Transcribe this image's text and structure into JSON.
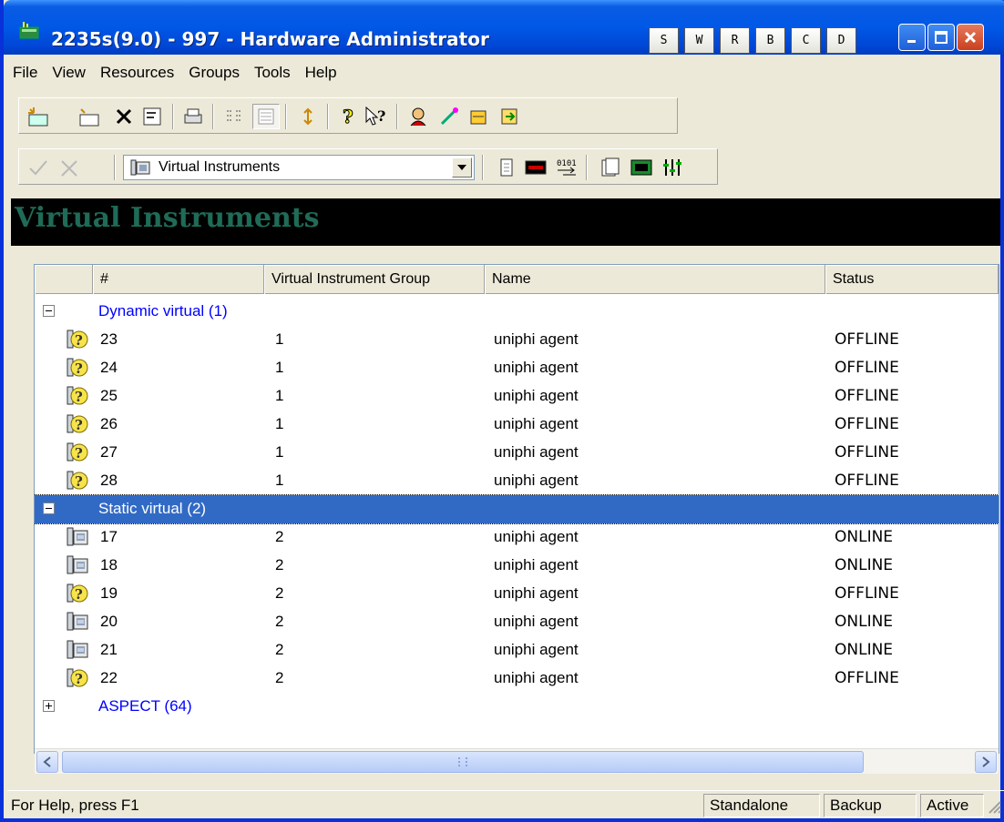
{
  "window": {
    "title": "2235s(9.0) - 997 - Hardware Administrator",
    "hw_buttons": [
      "S",
      "W",
      "R",
      "B",
      "C",
      "D"
    ]
  },
  "menu": [
    "File",
    "View",
    "Resources",
    "Groups",
    "Tools",
    "Help"
  ],
  "toolbar2": {
    "combo_value": "Virtual Instruments"
  },
  "banner": {
    "title": "Virtual Instruments"
  },
  "list": {
    "columns": [
      "#",
      "Virtual Instrument Group",
      "Name",
      "Status"
    ],
    "groups": [
      {
        "label": "Dynamic virtual (1)",
        "expanded": true,
        "rows": [
          {
            "num": "23",
            "group": "1",
            "name": "uniphi agent",
            "status": "OFFLINE",
            "icon": "offline-agent-icon"
          },
          {
            "num": "24",
            "group": "1",
            "name": "uniphi agent",
            "status": "OFFLINE",
            "icon": "offline-agent-icon"
          },
          {
            "num": "25",
            "group": "1",
            "name": "uniphi agent",
            "status": "OFFLINE",
            "icon": "offline-agent-icon"
          },
          {
            "num": "26",
            "group": "1",
            "name": "uniphi agent",
            "status": "OFFLINE",
            "icon": "offline-agent-icon"
          },
          {
            "num": "27",
            "group": "1",
            "name": "uniphi agent",
            "status": "OFFLINE",
            "icon": "offline-agent-icon"
          },
          {
            "num": "28",
            "group": "1",
            "name": "uniphi agent",
            "status": "OFFLINE",
            "icon": "offline-agent-icon"
          }
        ]
      },
      {
        "label": "Static virtual (2)",
        "expanded": true,
        "selected": true,
        "rows": [
          {
            "num": "17",
            "group": "2",
            "name": "uniphi agent",
            "status": "ONLINE",
            "icon": "phone-icon"
          },
          {
            "num": "18",
            "group": "2",
            "name": "uniphi agent",
            "status": "ONLINE",
            "icon": "phone-icon"
          },
          {
            "num": "19",
            "group": "2",
            "name": "uniphi agent",
            "status": "OFFLINE",
            "icon": "offline-agent-icon"
          },
          {
            "num": "20",
            "group": "2",
            "name": "uniphi agent",
            "status": "ONLINE",
            "icon": "phone-icon"
          },
          {
            "num": "21",
            "group": "2",
            "name": "uniphi agent",
            "status": "ONLINE",
            "icon": "phone-icon"
          },
          {
            "num": "22",
            "group": "2",
            "name": "uniphi agent",
            "status": "OFFLINE",
            "icon": "offline-agent-icon"
          }
        ]
      },
      {
        "label": "ASPECT (64)",
        "expanded": false,
        "rows": []
      }
    ]
  },
  "status": {
    "help_text": "For Help, press F1",
    "panes": [
      "Standalone",
      "Backup",
      "Active"
    ]
  },
  "colors": {
    "titlebar": "#0058e6",
    "selection": "#316ac5",
    "group_link": "#0000ff",
    "banner_text": "#1f6b57"
  }
}
